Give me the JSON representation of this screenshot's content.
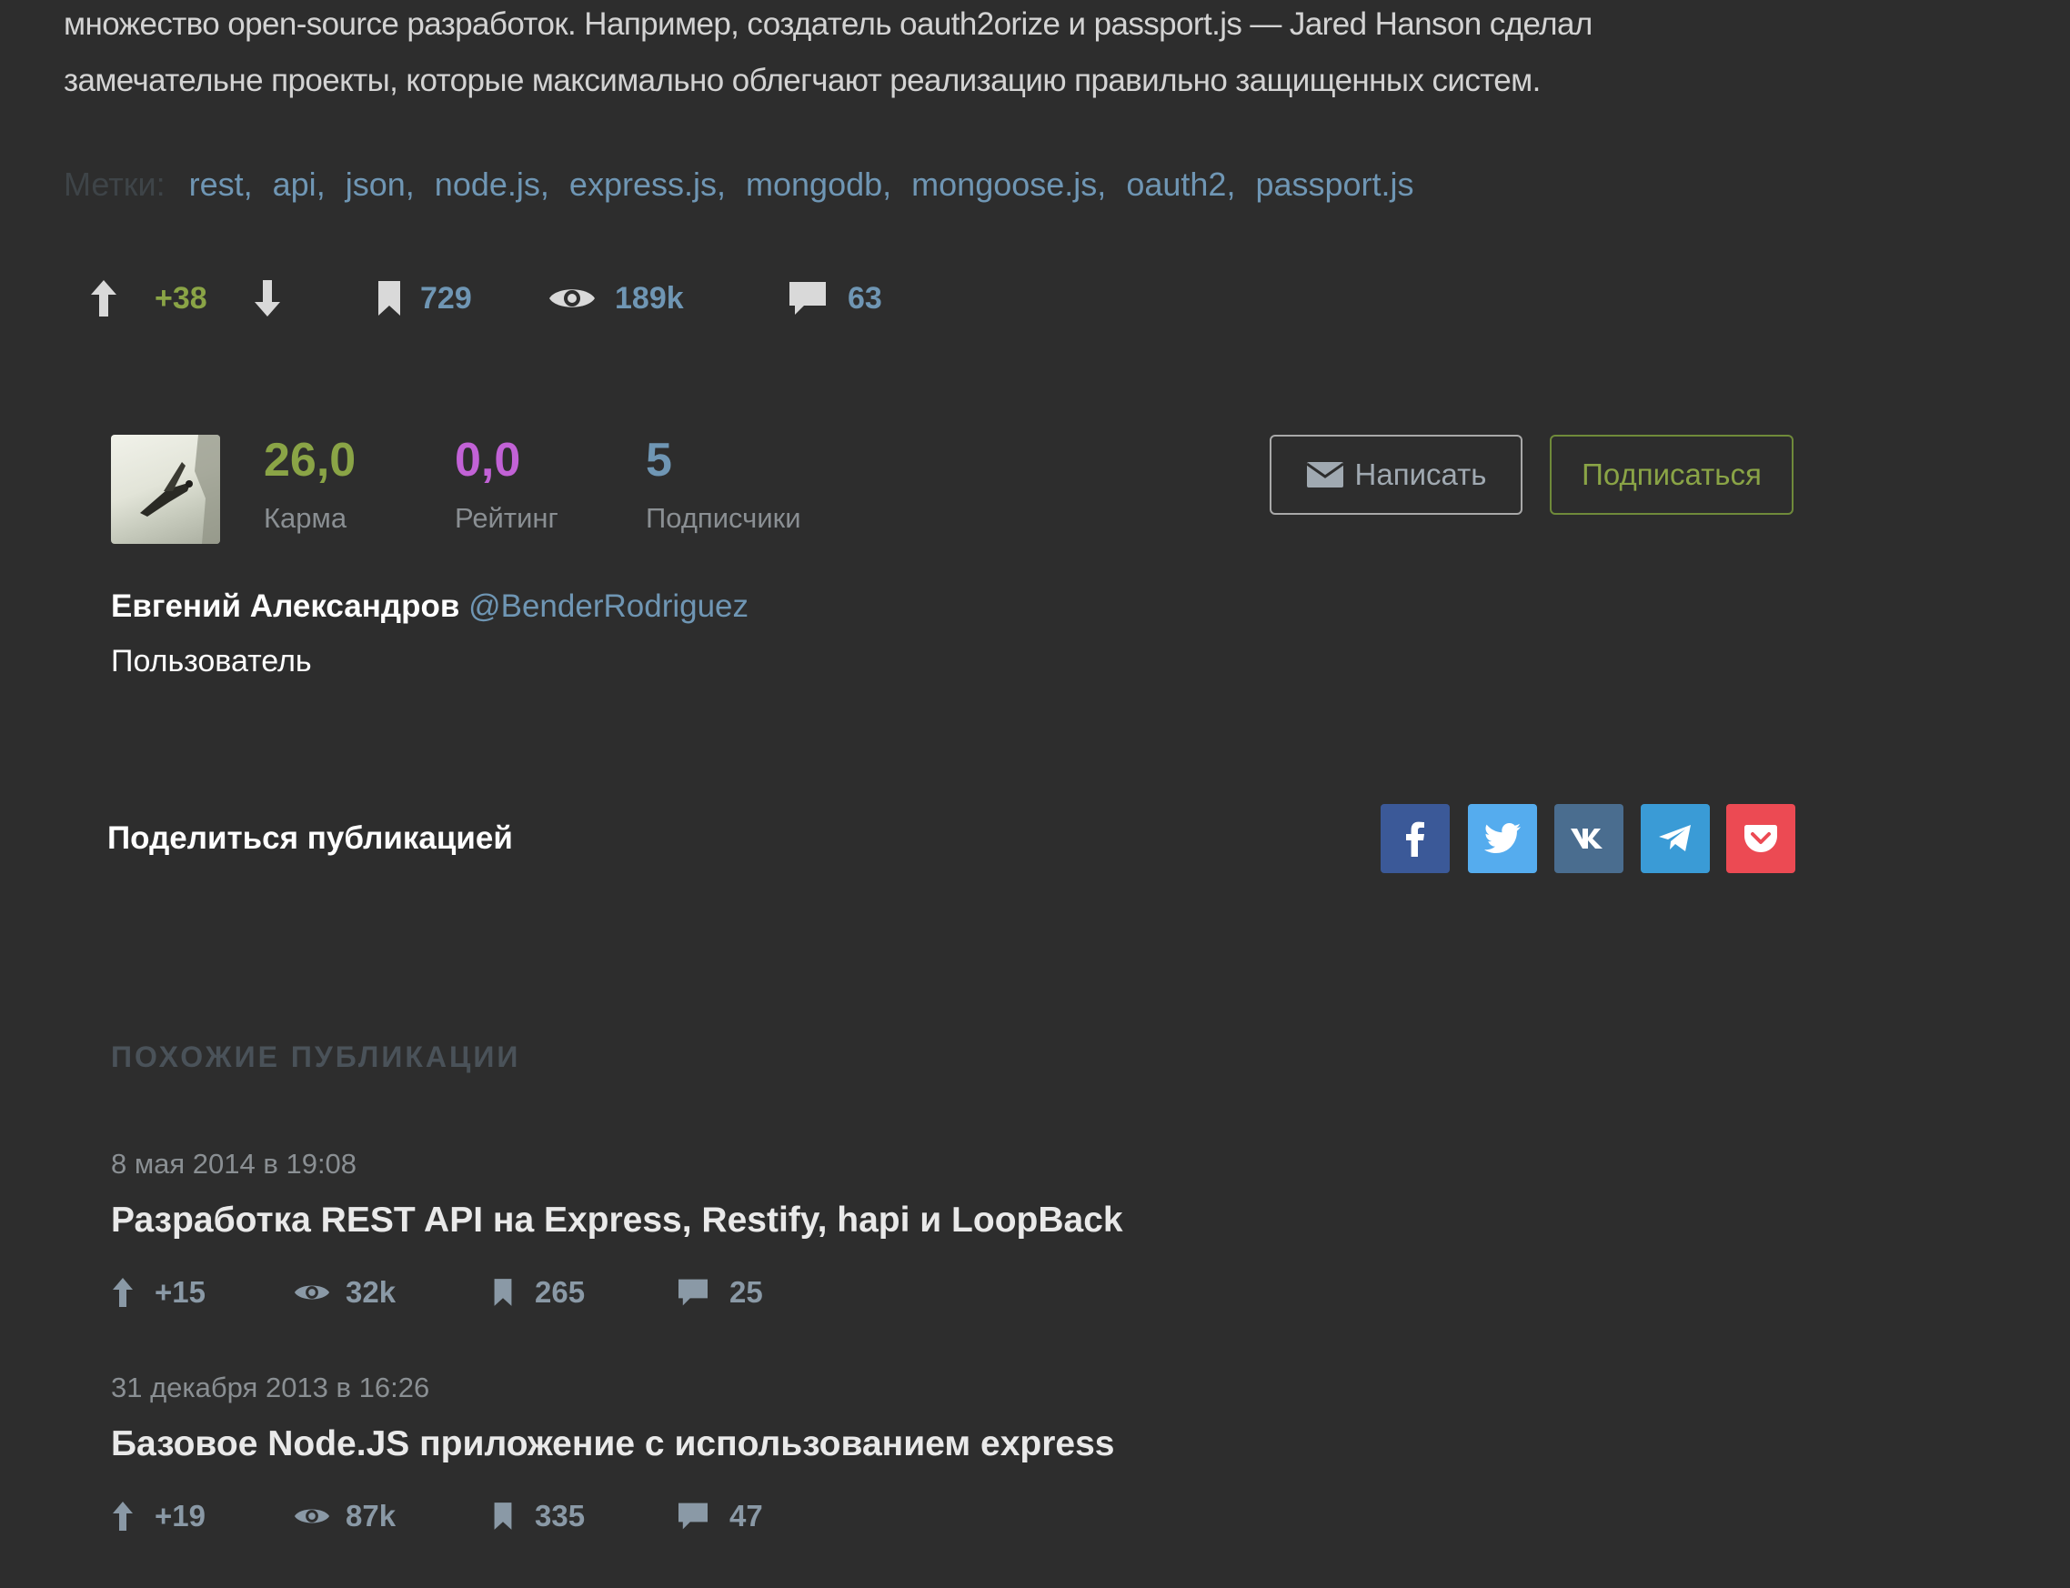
{
  "article": {
    "line1": "множество open-source разработок. Например, создатель oauth2orize и passport.js — Jared Hanson сделал",
    "line2": "замечательне проекты, которые максимально облегчают реализацию правильно защищенных систем."
  },
  "tags": {
    "label": "Метки:",
    "items": [
      "rest",
      "api",
      "json",
      "node.js",
      "express.js",
      "mongodb",
      "mongoose.js",
      "oauth2",
      "passport.js"
    ]
  },
  "post_stats": {
    "score": "+38",
    "bookmarks": "729",
    "views": "189k",
    "comments": "63"
  },
  "author": {
    "karma_value": "26,0",
    "karma_label": "Карма",
    "rating_value": "0,0",
    "rating_label": "Рейтинг",
    "followers_value": "5",
    "followers_label": "Подписчики",
    "write_label": "Написать",
    "subscribe_label": "Подписаться",
    "name": "Евгений Александров",
    "nick": "@BenderRodriguez",
    "role": "Пользователь"
  },
  "share": {
    "title": "Поделиться публикацией",
    "networks": [
      {
        "name": "facebook",
        "color": "#3b5998"
      },
      {
        "name": "twitter",
        "color": "#55acee"
      },
      {
        "name": "vk",
        "color": "#4a6d8f"
      },
      {
        "name": "telegram",
        "color": "#3a9bd6"
      },
      {
        "name": "pocket",
        "color": "#ec4a53"
      }
    ]
  },
  "similar": {
    "heading": "ПОХОЖИЕ ПУБЛИКАЦИИ",
    "posts": [
      {
        "date": "8 мая 2014 в 19:08",
        "title": "Разработка REST API на Express, Restify, hapi и LoopBack",
        "score": "+15",
        "views": "32k",
        "bookmarks": "265",
        "comments": "25"
      },
      {
        "date": "31 декабря 2013 в 16:26",
        "title": "Базовое Node.JS приложение с использованием express",
        "score": "+19",
        "views": "87k",
        "bookmarks": "335",
        "comments": "47"
      }
    ]
  },
  "colors": {
    "background": "#2d2d2d",
    "link": "#6f96b4",
    "karma": "#8aa446",
    "rating": "#c262d6",
    "followers": "#6f96b4"
  }
}
